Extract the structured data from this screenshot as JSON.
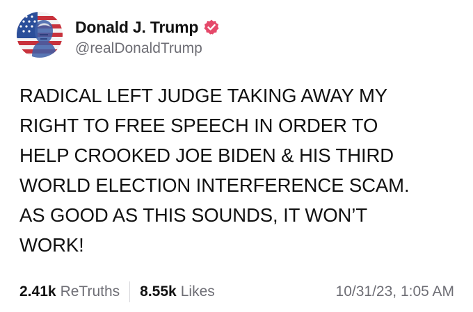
{
  "author": {
    "display_name": "Donald J. Trump",
    "handle": "@realDonaldTrump",
    "avatar_icon": "flag-portrait-avatar",
    "verified_icon": "verified-badge-icon",
    "verified_color": "#e5496a"
  },
  "post": {
    "lines": [
      "RADICAL LEFT JUDGE TAKING AWAY MY",
      "RIGHT TO FREE SPEECH IN ORDER TO",
      "HELP CROOKED JOE BIDEN & HIS THIRD",
      "WORLD ELECTION INTERFERENCE SCAM.",
      "AS GOOD AS THIS SOUNDS, IT WON’T",
      "WORK!"
    ]
  },
  "stats": {
    "retruths_count": "2.41k",
    "retruths_label": "ReTruths",
    "likes_count": "8.55k",
    "likes_label": "Likes"
  },
  "timestamp": "10/31/23, 1:05 AM"
}
